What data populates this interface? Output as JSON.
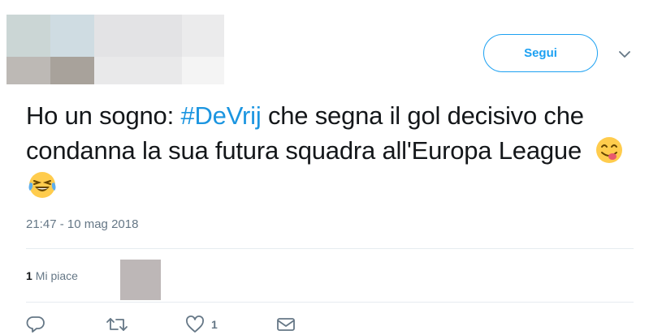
{
  "header": {
    "follow_label": "Segui",
    "caret_icon": "chevron-down-icon",
    "avatar_mosaic_colors": [
      "#c9d6d6",
      "#cfd9df",
      "#e4e4e6",
      "#ececec",
      "#f2f2f2",
      "#bdbab6",
      "#a9a39c",
      "#dcdcdd",
      "#ececec",
      "#f5f5f5"
    ]
  },
  "tweet": {
    "text_before_hashtag": "Ho un sogno: ",
    "hashtag": "#DeVrij",
    "text_after_hashtag": " che segna il gol decisivo che condanna la sua futura squadra all'Europa League",
    "emojis": [
      "face-savoring-food-emoji",
      "face-with-tears-of-joy-emoji"
    ],
    "timestamp": "21:47 - 10 mag 2018"
  },
  "likes": {
    "count": "1",
    "label": "Mi piace"
  },
  "actions": {
    "reply_icon": "reply-icon",
    "retweet_icon": "retweet-icon",
    "like_icon": "heart-icon",
    "like_count": "1",
    "message_icon": "envelope-icon"
  },
  "colors": {
    "accent": "#1da1f2",
    "hashtag": "#1b95e0",
    "muted": "#657786",
    "text": "#14171a"
  }
}
